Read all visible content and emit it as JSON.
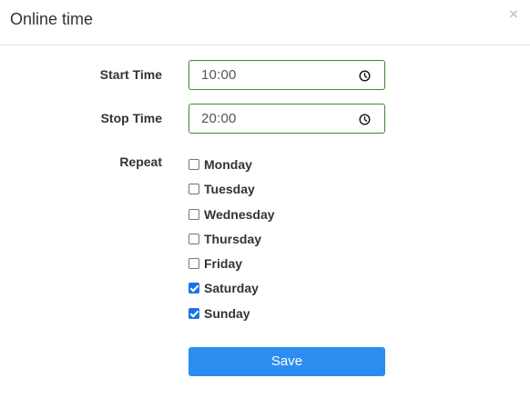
{
  "dialog": {
    "title": "Online time",
    "close_label": "×"
  },
  "form": {
    "start_time": {
      "label": "Start Time",
      "value": "10:00"
    },
    "stop_time": {
      "label": "Stop Time",
      "value": "20:00"
    },
    "repeat": {
      "label": "Repeat",
      "days": [
        {
          "label": "Monday",
          "checked": false
        },
        {
          "label": "Tuesday",
          "checked": false
        },
        {
          "label": "Wednesday",
          "checked": false
        },
        {
          "label": "Thursday",
          "checked": false
        },
        {
          "label": "Friday",
          "checked": false
        },
        {
          "label": "Saturday",
          "checked": true
        },
        {
          "label": "Sunday",
          "checked": true
        }
      ]
    },
    "save_label": "Save"
  },
  "colors": {
    "input_border": "#3c8a2e",
    "checkbox_checked": "#1a73e8",
    "primary_button": "#2d8cf0"
  },
  "icons": {
    "close": "close-icon",
    "clock": "clock-icon"
  }
}
